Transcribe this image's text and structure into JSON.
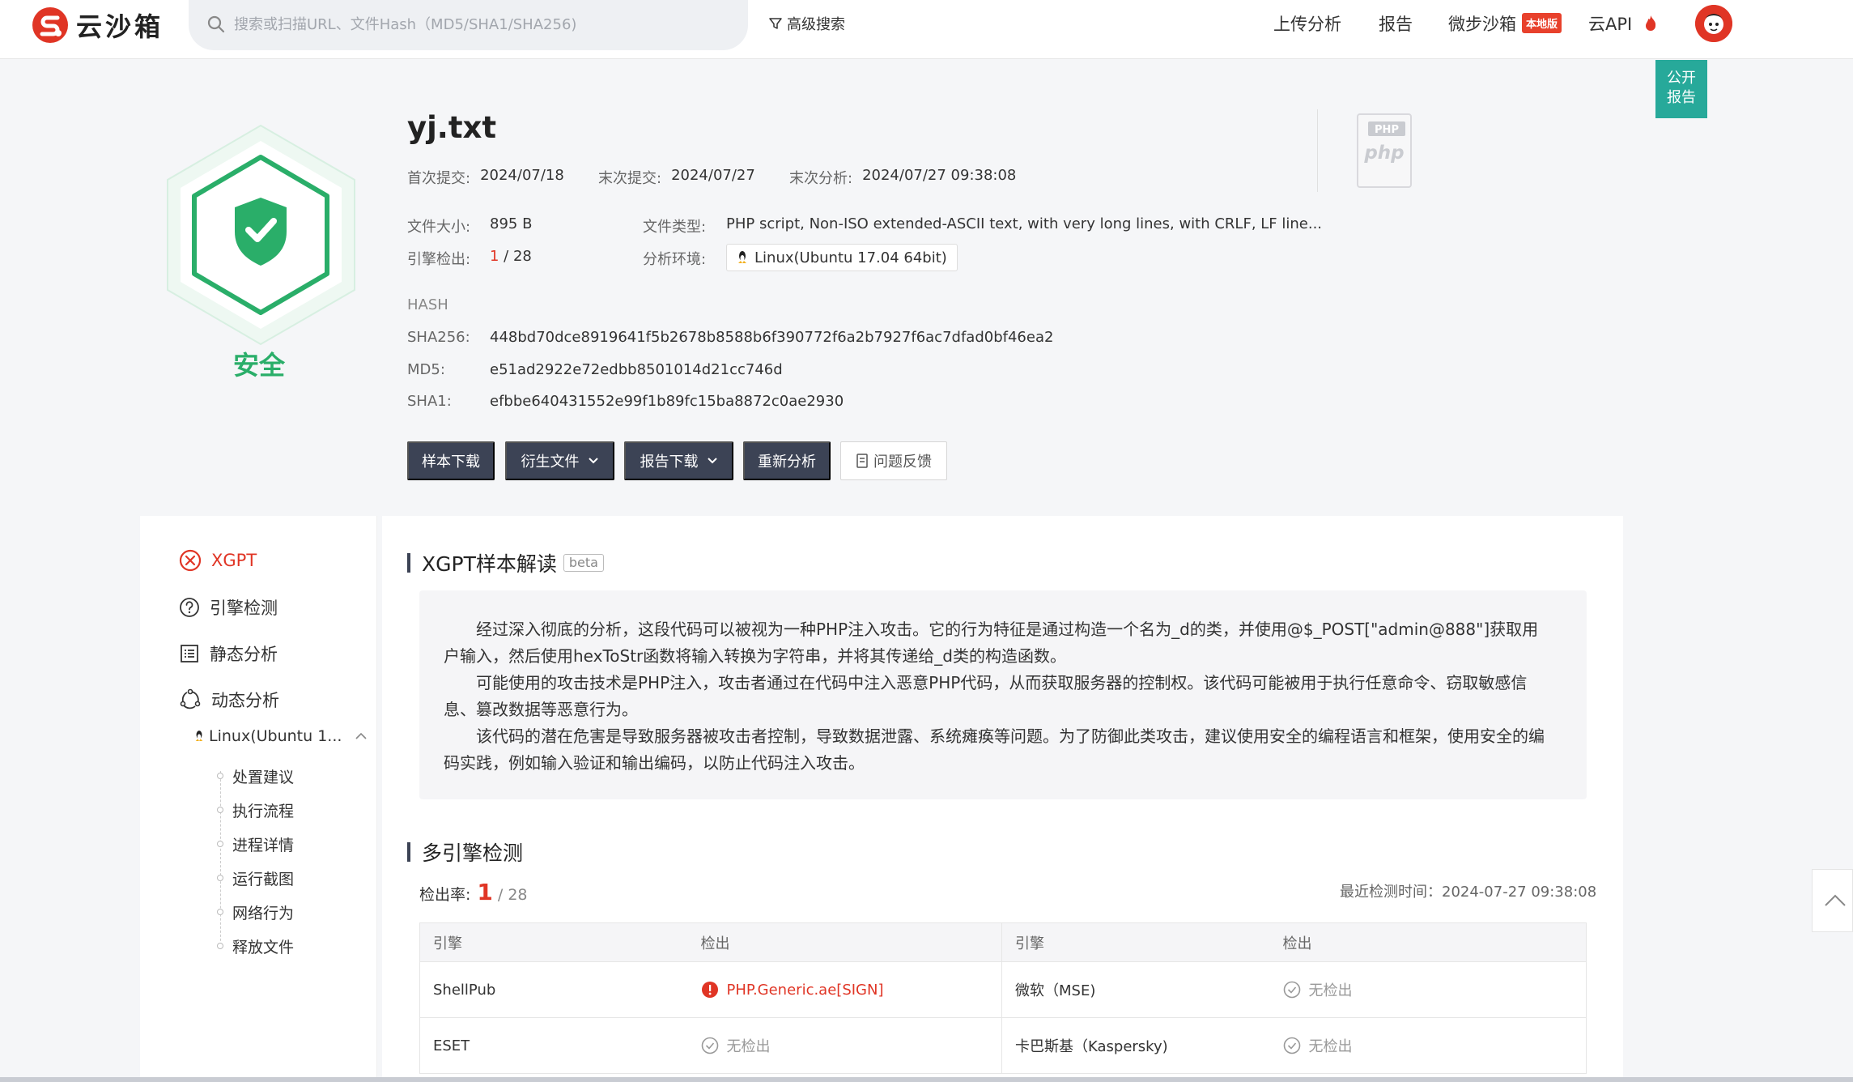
{
  "header": {
    "logo_text": "云沙箱",
    "search_placeholder": "搜索或扫描URL、文件Hash（MD5/SHA1/SHA256)",
    "adv_search": "高级搜索",
    "nav_upload": "上传分析",
    "nav_report": "报告",
    "nav_micro": "微步沙箱",
    "badge_local": "本地版",
    "nav_api": "云API",
    "public_report": [
      "公开",
      "报告"
    ]
  },
  "summary": {
    "verdict": "安全",
    "file_name": "yj.txt",
    "first_submit_label": "首次提交:",
    "first_submit": "2024/07/18",
    "last_submit_label": "末次提交:",
    "last_submit": "2024/07/27",
    "last_analysis_label": "末次分析:",
    "last_analysis": "2024/07/27 09:38:08",
    "size_label": "文件大小:",
    "size": "895 B",
    "type_label": "文件类型:",
    "type": "PHP script, Non-ISO extended-ASCII text, with very long lines, with CRLF, LF line...",
    "engine_label": "引擎检出:",
    "engine_hits": "1",
    "engine_total": " / 28",
    "env_label": "分析环境:",
    "env": "Linux(Ubuntu 17.04 64bit)",
    "hash_title": "HASH",
    "sha256_label": "SHA256:",
    "sha256": "448bd70dce8919641f5b2678b8588b6f390772f6a2b7927f6ac7dfad0bf46ea2",
    "md5_label": "MD5:",
    "md5": "e51ad2922e72edbb8501014d21cc746d",
    "sha1_label": "SHA1:",
    "sha1": "efbbe640431552e99f1b89fc15ba8872c0ae2930",
    "php_badge": "PHP",
    "php_text": "php"
  },
  "actions": {
    "download": "样本下载",
    "derived": "衍生文件",
    "report_dl": "报告下载",
    "reanalyze": "重新分析",
    "feedback": "问题反馈"
  },
  "sidebar": {
    "xgpt": "XGPT",
    "engine": "引擎检测",
    "static": "静态分析",
    "dynamic": "动态分析",
    "env_sub": "Linux(Ubuntu 1...",
    "tree": [
      "处置建议",
      "执行流程",
      "进程详情",
      "运行截图",
      "网络行为",
      "释放文件"
    ]
  },
  "xgpt": {
    "title": "XGPT样本解读",
    "beta": "beta",
    "paragraphs": [
      "经过深入彻底的分析，这段代码可以被视为一种PHP注入攻击。它的行为特征是通过构造一个名为_d的类，并使用@$_POST[\"admin@888\"]获取用户输入，然后使用hexToStr函数将输入转换为字符串，并将其传递给_d类的构造函数。",
      "可能使用的攻击技术是PHP注入，攻击者通过在代码中注入恶意PHP代码，从而获取服务器的控制权。该代码可能被用于执行任意命令、窃取敏感信息、篡改数据等恶意行为。",
      "该代码的潜在危害是导致服务器被攻击者控制，导致数据泄露、系统瘫痪等问题。为了防御此类攻击，建议使用安全的编程语言和框架，使用安全的编码实践，例如输入验证和输出编码，以防止代码注入攻击。"
    ]
  },
  "engines": {
    "title": "多引擎检测",
    "rate_label": "检出率:",
    "hits": "1",
    "total": "/ 28",
    "last_time": "最近检测时间：2024-07-27 09:38:08",
    "col_engine": "引擎",
    "col_detect": "检出",
    "rows": [
      {
        "e1": "ShellPub",
        "d1": "PHP.Generic.ae[SIGN]",
        "e2": "微软（MSE)",
        "d2": "无检出"
      },
      {
        "e1": "ESET",
        "d1": "无检出",
        "e2": "卡巴斯基（Kaspersky)",
        "d2": "无检出"
      }
    ]
  },
  "colors": {
    "accent_red": "#e03525",
    "safe_green": "#2aae69",
    "button_dark": "#3c4355",
    "teal": "#27a99a"
  }
}
